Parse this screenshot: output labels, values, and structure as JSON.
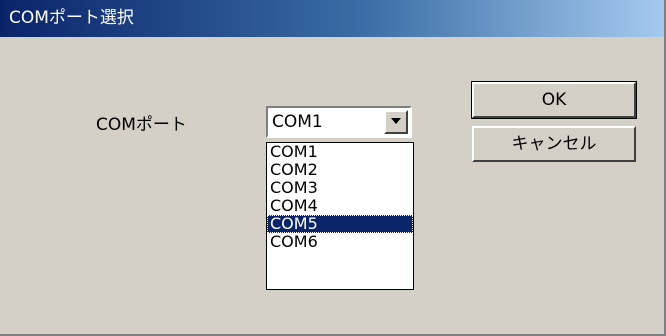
{
  "window": {
    "title": "COMポート選択"
  },
  "form": {
    "port_label": "COMポート",
    "selected_value": "COM1"
  },
  "dropdown": {
    "options": [
      "COM1",
      "COM2",
      "COM3",
      "COM4",
      "COM5",
      "COM6"
    ],
    "highlighted": "COM5"
  },
  "buttons": {
    "ok_label": "OK",
    "cancel_label": "キャンセル"
  },
  "icons": {
    "dropdown_arrow": "chevron-down-icon"
  },
  "colors": {
    "titlebar_start": "#0a246a",
    "titlebar_end": "#a6caf0",
    "dialog_bg": "#d4d0c8",
    "highlight": "#0a246a"
  }
}
